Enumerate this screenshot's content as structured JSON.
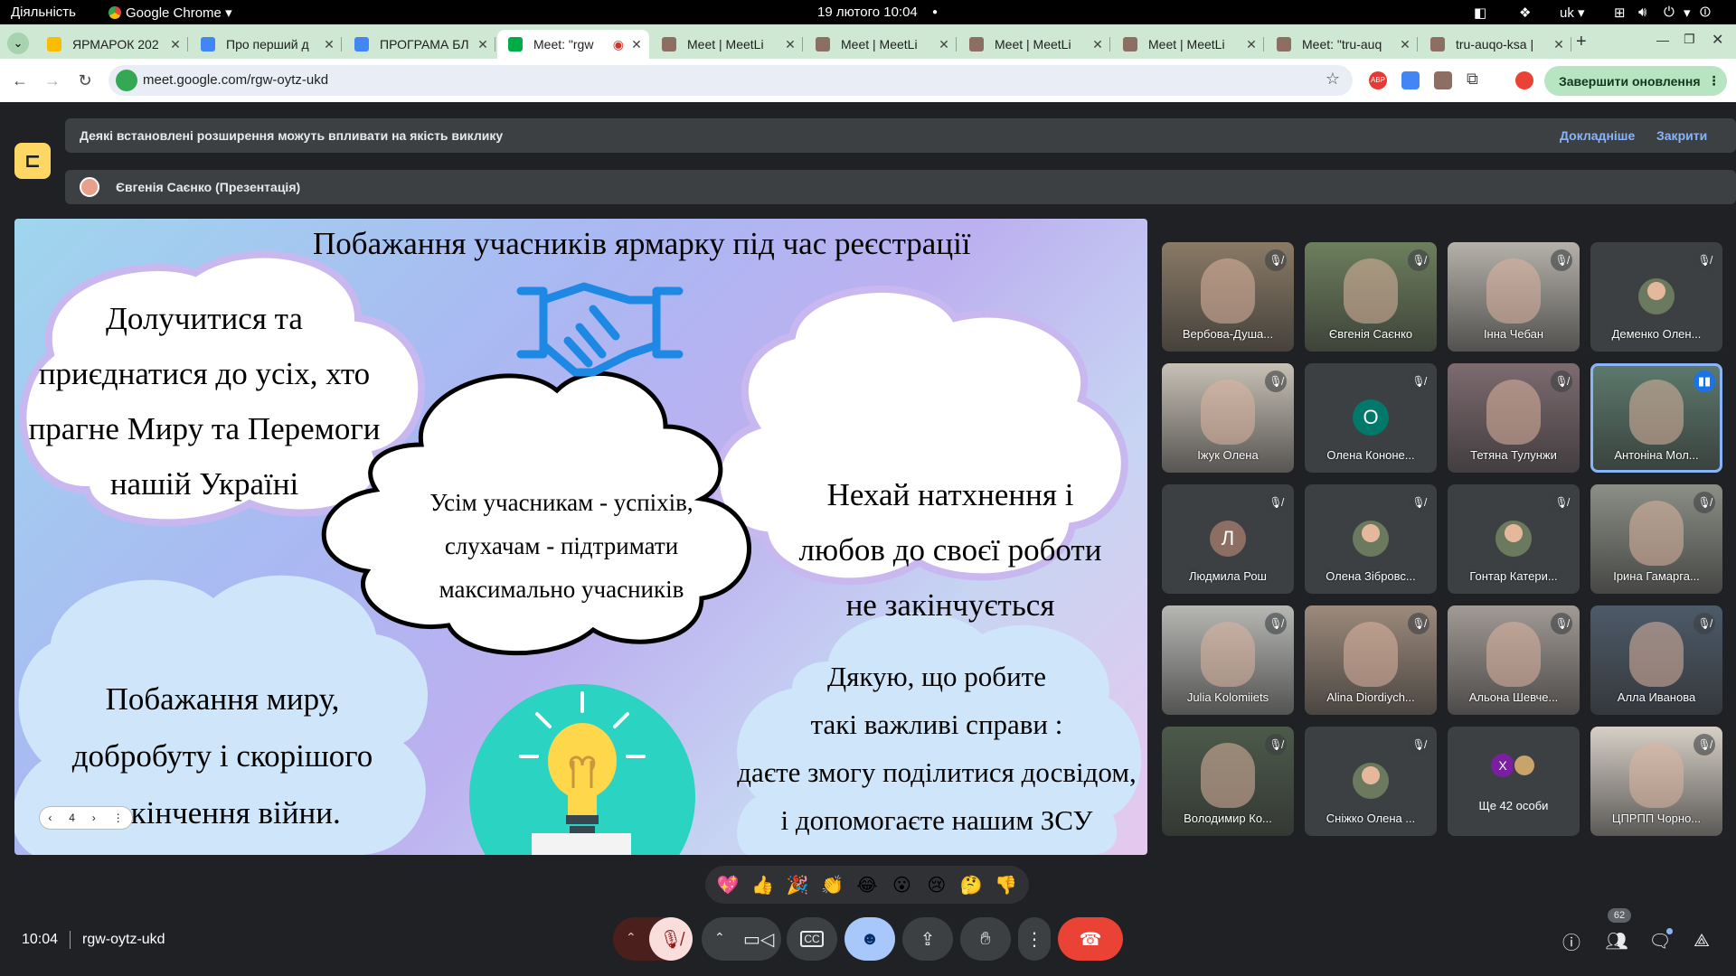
{
  "system": {
    "activities": "Діяльність",
    "app_name": "Google Chrome",
    "datetime": "19 лютого  10:04",
    "lang": "uk"
  },
  "tabs": [
    {
      "title": "ЯРМАРОК 202",
      "favicon": "drive",
      "color": "#fbbc04"
    },
    {
      "title": "Про перший д",
      "favicon": "docs",
      "color": "#4285f4"
    },
    {
      "title": "ПРОГРАМА БЛ",
      "favicon": "docs",
      "color": "#4285f4"
    },
    {
      "title": "Meet: \"rgw",
      "favicon": "meet",
      "color": "#00ac47",
      "active": true
    },
    {
      "title": "Meet | MeetLi",
      "favicon": "owl",
      "color": "#8d6e63"
    },
    {
      "title": "Meet | MeetLi",
      "favicon": "owl",
      "color": "#8d6e63"
    },
    {
      "title": "Meet | MeetLi",
      "favicon": "owl",
      "color": "#8d6e63"
    },
    {
      "title": "Meet | MeetLi",
      "favicon": "owl",
      "color": "#8d6e63"
    },
    {
      "title": "Meet: \"tru-auq",
      "favicon": "owl",
      "color": "#8d6e63"
    },
    {
      "title": "tru-auqo-ksa |",
      "favicon": "owl",
      "color": "#8d6e63"
    }
  ],
  "toolbar": {
    "url": "meet.google.com/rgw-oytz-ukd",
    "update_label": "Завершити оновлення"
  },
  "meet": {
    "notice": "Деякі встановлені розширення можуть впливати на якість виклику",
    "learn_more": "Докладніше",
    "close": "Закрити",
    "presenter": "Євгенія Саєнко (Презентація)",
    "clock": "10:04",
    "meeting_code": "rgw-oytz-ukd",
    "participants_count": "62",
    "slide_page": "4"
  },
  "slide": {
    "title": "Побажання учасників ярмарку під час реєстрації",
    "cloud1": [
      "Долучитися та",
      "приєднатися до усіх, хто",
      "прагне Миру та Перемоги",
      "нашій Україні"
    ],
    "cloud2": [
      "Нехай натхнення і",
      "любов до своєї роботи",
      "не закінчується"
    ],
    "cloud3": [
      "Усім учасникам - успіхів,",
      "слухачам - підтримати",
      "максимально учасників"
    ],
    "cloud4": [
      "Побажання миру,",
      "добробуту і скорішого",
      "закінчення війни."
    ],
    "cloud5": [
      "Дякую, що робите",
      "такі важливі справи :",
      "даєте змогу поділитися досвідом,",
      "і допомогаєте нашим ЗСУ"
    ]
  },
  "participants": [
    {
      "name": "Вербова-Душа...",
      "type": "video",
      "bg": "#8a7a66"
    },
    {
      "name": "Євгенія Саєнко",
      "type": "video",
      "bg": "#6d7f5d"
    },
    {
      "name": "Інна Чебан",
      "type": "video",
      "bg": "#b5b1aa"
    },
    {
      "name": "Деменко Олен...",
      "type": "photo",
      "bg": "#3c4043"
    },
    {
      "name": "Іжук Олена",
      "type": "video",
      "bg": "#c7c0b5"
    },
    {
      "name": "Олена Кононе...",
      "type": "initial",
      "initial": "О",
      "avatar_color": "#00796b"
    },
    {
      "name": "Тетяна Тулунжи",
      "type": "video",
      "bg": "#7d6b70"
    },
    {
      "name": "Антоніна Мол...",
      "type": "video",
      "bg": "#5d7a6d",
      "speaking": true
    },
    {
      "name": "Людмила Рош",
      "type": "initial",
      "initial": "Л",
      "avatar_color": "#8d6e63"
    },
    {
      "name": "Олена Зібровс...",
      "type": "photo",
      "bg": "#3c4043"
    },
    {
      "name": "Гонтар Катери...",
      "type": "photo",
      "bg": "#3c4043"
    },
    {
      "name": "Ірина Гамарга...",
      "type": "video",
      "bg": "#8b8f86"
    },
    {
      "name": "Julia Kolomiiets",
      "type": "video",
      "bg": "#b7b8b4"
    },
    {
      "name": "Alina Diordiych...",
      "type": "video",
      "bg": "#9c8a7c"
    },
    {
      "name": "Альона Шевче...",
      "type": "video",
      "bg": "#a19a95"
    },
    {
      "name": "Алла Иванова",
      "type": "video",
      "bg": "#4d5a69"
    },
    {
      "name": "Володимир Ко...",
      "type": "video",
      "bg": "#4c5a4a"
    },
    {
      "name": "Сніжко Олена ...",
      "type": "photo",
      "bg": "#3c4043"
    },
    {
      "name": "Ще 42 особи",
      "type": "more",
      "initial": "Х"
    },
    {
      "name": "ЦПРПП Чорно...",
      "type": "video",
      "bg": "#d6cfc6"
    }
  ],
  "reactions": [
    "💖",
    "👍",
    "🎉",
    "👏",
    "😂",
    "😮",
    "😢",
    "🤔",
    "👎"
  ],
  "colors": {
    "meet_bg": "#202124",
    "tab_strip": "#cfe8d3",
    "end_call": "#ea4335",
    "mic_off": "#f9dedc",
    "emoji_active": "#a8c7fa"
  }
}
